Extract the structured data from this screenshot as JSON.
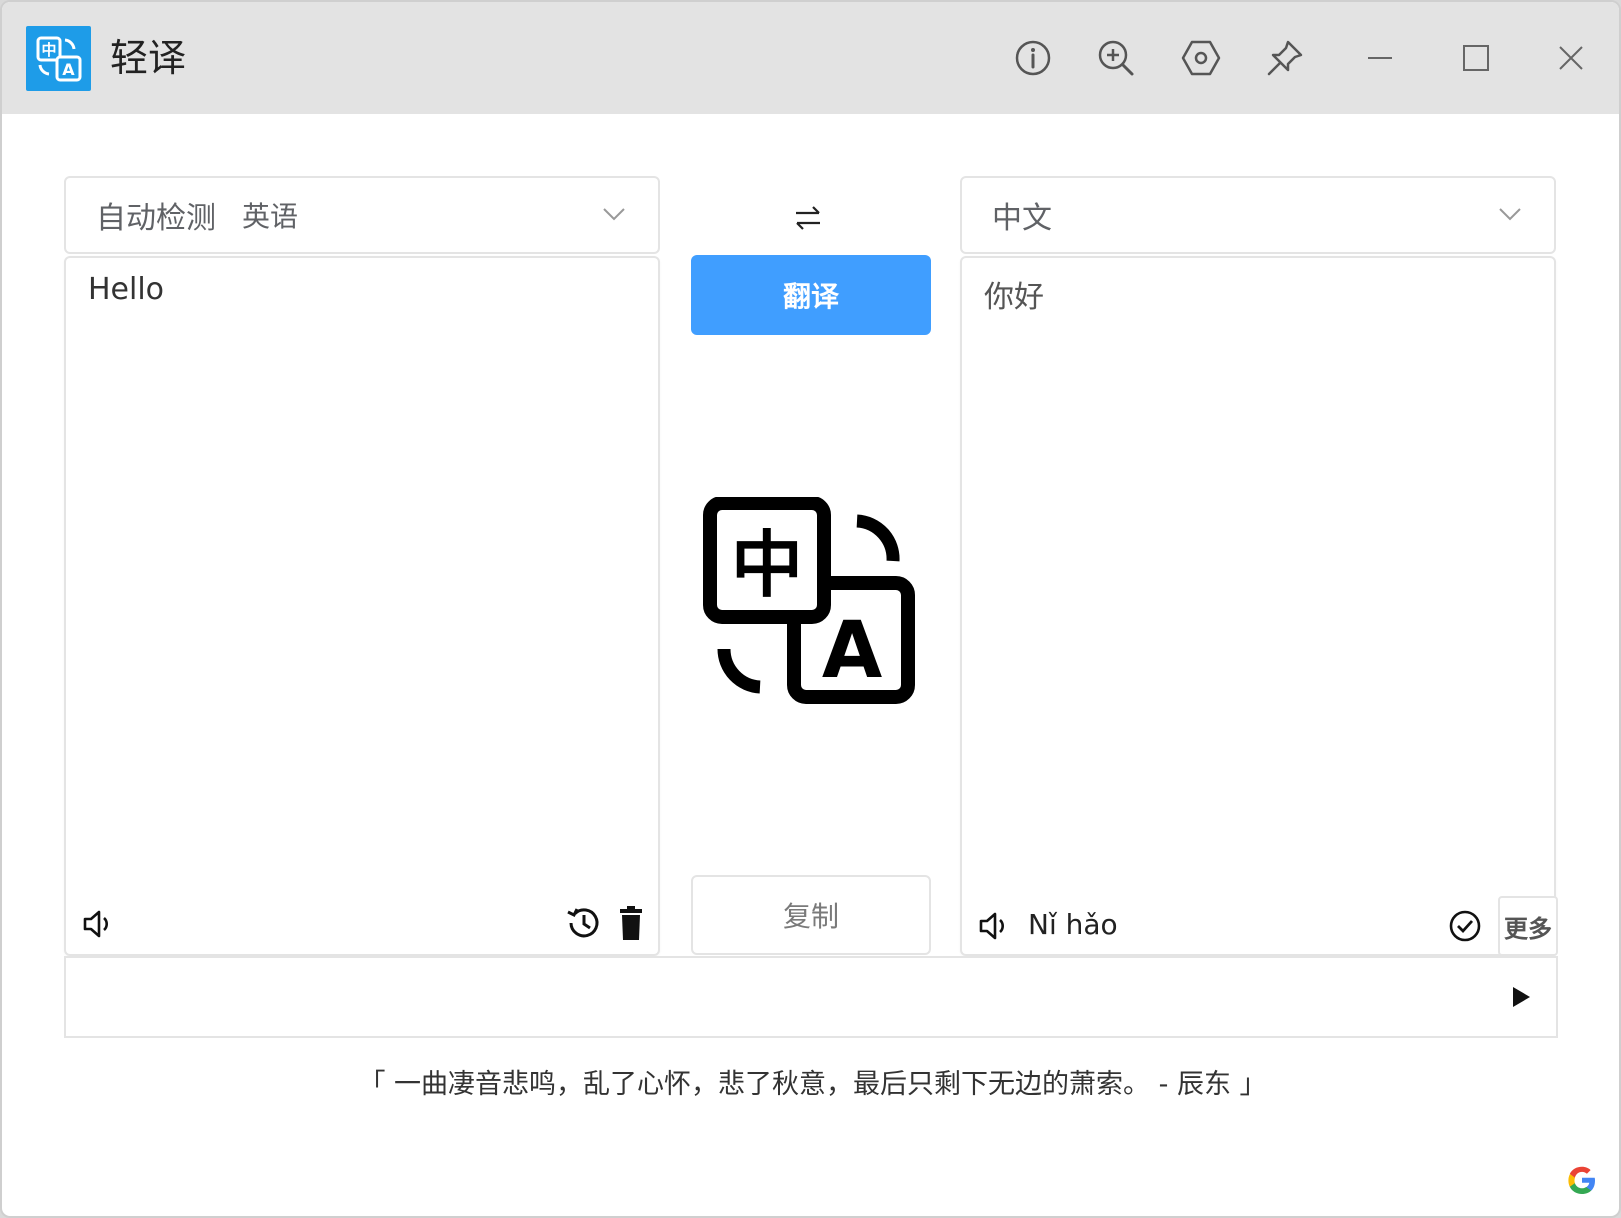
{
  "window": {
    "title": "轻译",
    "logo_icon": "translate-logo-icon",
    "controls": [
      "info-icon",
      "zoom-in-icon",
      "settings-icon",
      "pin-icon",
      "minimize-icon",
      "maximize-icon",
      "close-icon"
    ]
  },
  "source": {
    "language_label": "自动检测",
    "detected_language": "英语",
    "text": "Hello"
  },
  "target": {
    "language_label": "中文",
    "text": "你好",
    "pinyin": "Nǐ hǎo"
  },
  "actions": {
    "swap_icon": "swap-arrows-icon",
    "translate_label": "翻译",
    "copy_label": "复制",
    "more_label": "更多"
  },
  "center_illustration": {
    "text_zh": "中",
    "text_en": "A"
  },
  "quote": "「 一曲凄音悲鸣，乱了心怀，悲了秋意，最后只剩下无边的萧索。 - 辰东 」",
  "colors": {
    "accent": "#409eff",
    "logo_bg": "#1e9ce8",
    "titlebar": "#e3e3e3"
  }
}
